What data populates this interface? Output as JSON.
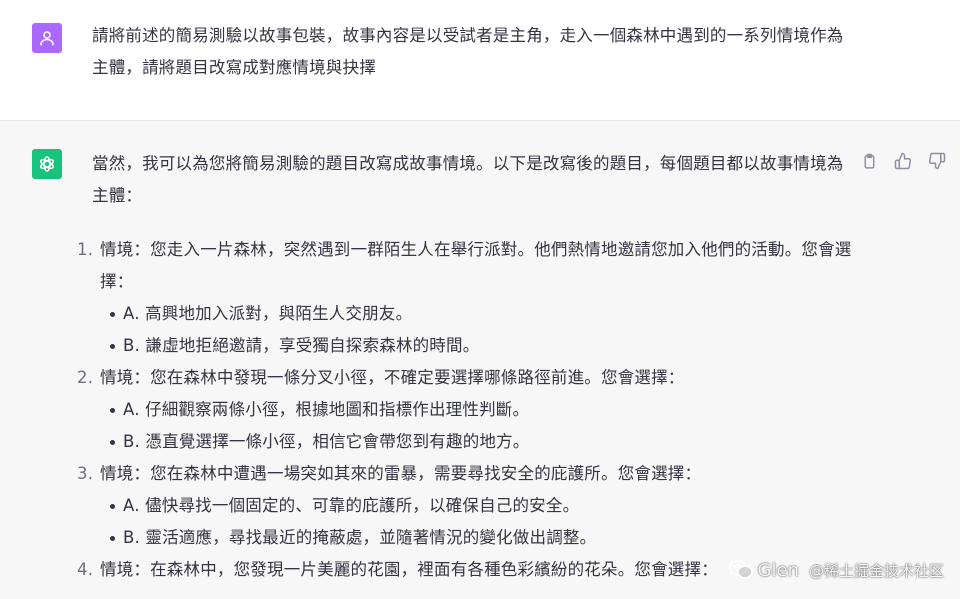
{
  "user": {
    "avatar_icon": "user-icon",
    "avatar_color": "#ab68ff",
    "message": "請將前述的簡易測驗以故事包裝，故事內容是以受試者是主角，走入一個森林中遇到的一系列情境作為主體，請將題目改寫成對應情境與抉擇"
  },
  "assistant": {
    "avatar_icon": "openai-logo-icon",
    "avatar_color": "#19c37d",
    "intro": "當然，我可以為您將簡易測驗的題目改寫成故事情境。以下是改寫後的題目，每個題目都以故事情境為主體：",
    "items": [
      {
        "number": "1.",
        "scenario": "情境：您走入一片森林，突然遇到一群陌生人在舉行派對。他們熱情地邀請您加入他們的活動。您會選擇：",
        "options": [
          "A. 高興地加入派對，與陌生人交朋友。",
          "B. 謙虛地拒絕邀請，享受獨自探索森林的時間。"
        ]
      },
      {
        "number": "2.",
        "scenario": "情境：您在森林中發現一條分叉小徑，不確定要選擇哪條路徑前進。您會選擇：",
        "options": [
          "A. 仔細觀察兩條小徑，根據地圖和指標作出理性判斷。",
          "B. 憑直覺選擇一條小徑，相信它會帶您到有趣的地方。"
        ]
      },
      {
        "number": "3.",
        "scenario": "情境：您在森林中遭遇一場突如其來的雷暴，需要尋找安全的庇護所。您會選擇：",
        "options": [
          "A. 儘快尋找一個固定的、可靠的庇護所，以確保自己的安全。",
          "B. 靈活適應，尋找最近的掩蔽處，並隨著情況的變化做出調整。"
        ]
      },
      {
        "number": "4.",
        "scenario": "情境：在森林中，您發現一片美麗的花園，裡面有各種色彩繽紛的花朵。您會選擇：",
        "options": []
      }
    ],
    "actions": [
      "copy-icon",
      "thumbs-up-icon",
      "thumbs-down-icon"
    ]
  },
  "watermark": {
    "name": "Glen",
    "site": "@稀土掘金技术社区"
  }
}
